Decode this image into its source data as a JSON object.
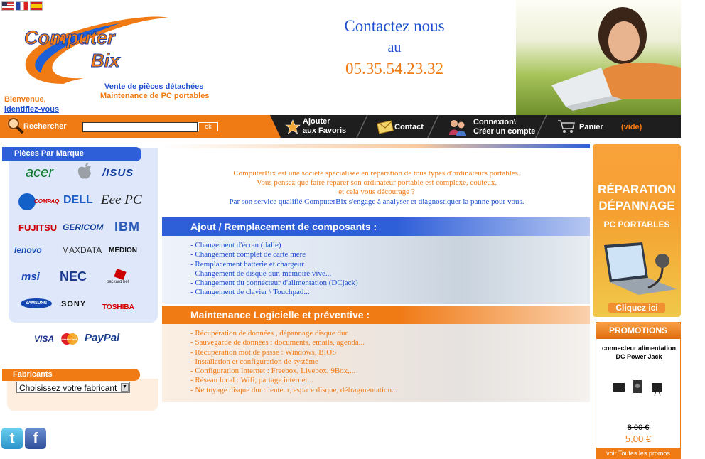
{
  "languages": [
    {
      "name": "english-flag"
    },
    {
      "name": "french-flag"
    },
    {
      "name": "spanish-flag"
    }
  ],
  "header": {
    "logo_line1": "Computer",
    "logo_line2": "Bix",
    "tagline1": "Vente de pièces détachées",
    "tagline2": "Maintenance de PC portables",
    "welcome": "Bienvenue,",
    "login_link": "identifiez-vous",
    "contact_title": "Contactez nous",
    "contact_au": "au",
    "phone": "05.35.54.23.32"
  },
  "nav": {
    "search_label": "Rechercher",
    "search_value": "",
    "search_button": "ok",
    "favorites_line1": "Ajouter",
    "favorites_line2": "aux Favoris",
    "contact": "Contact",
    "login_line1": "Connexion\\",
    "login_line2": "Créer un compte",
    "cart": "Panier",
    "cart_status": "(vide)"
  },
  "sidebar": {
    "brands_title": "Pièces Par Marque",
    "brands": [
      "acer",
      "",
      "/ISUS",
      "COMPAQ",
      "DELL",
      "Eee PC",
      "FUJITSU",
      "GERICOM",
      "IBM",
      "lenovo",
      "MAXDATA",
      "MEDION",
      "msi",
      "NEC",
      "packard bell",
      "SAMSUNG",
      "SONY",
      "TOSHIBA"
    ],
    "payments": [
      "VISA",
      "MasterCard",
      "PayPal"
    ],
    "manufacturers_title": "Fabricants",
    "manufacturer_select": "Choisissez votre fabricant"
  },
  "main": {
    "intro": [
      "ComputerBix est une société spécialisée en réparation de tous types d'ordinateurs portables.",
      "Vous pensez que faire réparer son ordinateur portable est complexe, coûteux,",
      "et cela vous décourage ?",
      "Par son service qualifié ComputerBix s'engage à analyser et diagnostiquer la panne pour vous."
    ],
    "section1_title": "Ajout / Remplacement de composants :",
    "section1_items": [
      "- Changement d'écran (dalle)",
      "- Changement complet de carte mère",
      "- Remplacement batterie et chargeur",
      "- Changement de disque dur, mémoire vive...",
      "- Changement du connecteur d'alimentation (DCjack)",
      "- Changement de clavier \\ Touchpad..."
    ],
    "section2_title": "Maintenance Logicielle et préventive :",
    "section2_items": [
      "- Récupération de données , dépannage disque dur",
      "- Sauvegarde de données : documents, emails, agenda...",
      "- Récupération mot de passe : Windows, BIOS",
      "- Installation et configuration de système",
      "- Configuration Internet : Freebox, Livebox, 9Box,...",
      "- Réseau local : Wifi, partage internet...",
      "- Nettoyage disque dur : lenteur, espace disque, défragmentation..."
    ]
  },
  "right": {
    "ad_line1": "RÉPARATION",
    "ad_line2": "DÉPANNAGE",
    "ad_line3": "PC PORTABLES",
    "ad_cta": "Cliquez ici",
    "promo_title": "PROMOTIONS",
    "promo_product": "connecteur alimentation DC Power Jack",
    "promo_old_price": "8,00 €",
    "promo_new_price": "5,00 €",
    "promo_link": "voir Toutes les promos"
  },
  "social": [
    "twitter",
    "facebook"
  ],
  "colors": {
    "orange": "#f07a14",
    "blue": "#2f5fd8",
    "dark": "#1e1e1e",
    "panel": "#dfe8fb"
  }
}
